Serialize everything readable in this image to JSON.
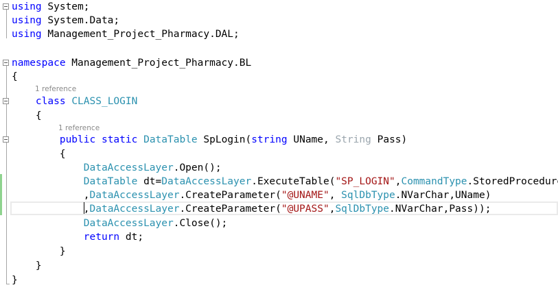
{
  "editor": {
    "language": "C#",
    "lines": [
      {
        "tokens": [
          {
            "c": "kw",
            "t": "using"
          },
          {
            "c": "tx",
            "t": " System;"
          }
        ]
      },
      {
        "tokens": [
          {
            "c": "kw",
            "t": "using"
          },
          {
            "c": "tx",
            "t": " System.Data;"
          }
        ]
      },
      {
        "tokens": [
          {
            "c": "kw",
            "t": "using"
          },
          {
            "c": "tx",
            "t": " Management_Project_Pharmacy.DAL;"
          }
        ]
      },
      {
        "tokens": []
      },
      {
        "tokens": [
          {
            "c": "kw",
            "t": "namespace"
          },
          {
            "c": "tx",
            "t": " Management_Project_Pharmacy.BL"
          }
        ]
      },
      {
        "tokens": [
          {
            "c": "tx",
            "t": "{"
          }
        ]
      },
      {
        "tokens": [
          {
            "c": "tx",
            "t": "    "
          },
          {
            "c": "kw",
            "t": "class"
          },
          {
            "c": "tx",
            "t": " "
          },
          {
            "c": "ty",
            "t": "CLASS_LOGIN"
          }
        ]
      },
      {
        "tokens": [
          {
            "c": "tx",
            "t": "    {"
          }
        ]
      },
      {
        "tokens": [
          {
            "c": "tx",
            "t": "        "
          },
          {
            "c": "kw",
            "t": "public"
          },
          {
            "c": "tx",
            "t": " "
          },
          {
            "c": "kw",
            "t": "static"
          },
          {
            "c": "tx",
            "t": " "
          },
          {
            "c": "ty",
            "t": "DataTable"
          },
          {
            "c": "tx",
            "t": " SpLogin("
          },
          {
            "c": "kw",
            "t": "string"
          },
          {
            "c": "tx",
            "t": " UName, "
          },
          {
            "c": "tyg",
            "t": "String"
          },
          {
            "c": "tx",
            "t": " Pass)"
          }
        ]
      },
      {
        "tokens": [
          {
            "c": "tx",
            "t": "        {"
          }
        ]
      },
      {
        "tokens": [
          {
            "c": "tx",
            "t": "            "
          },
          {
            "c": "ty",
            "t": "DataAccessLayer"
          },
          {
            "c": "tx",
            "t": ".Open();"
          }
        ]
      },
      {
        "tokens": [
          {
            "c": "tx",
            "t": "            "
          },
          {
            "c": "ty",
            "t": "DataTable"
          },
          {
            "c": "tx",
            "t": " dt="
          },
          {
            "c": "ty",
            "t": "DataAccessLayer"
          },
          {
            "c": "tx",
            "t": ".ExecuteTable("
          },
          {
            "c": "str",
            "t": "\"SP_LOGIN\""
          },
          {
            "c": "tx",
            "t": ","
          },
          {
            "c": "ty",
            "t": "CommandType"
          },
          {
            "c": "tx",
            "t": ".StoredProcedure"
          }
        ]
      },
      {
        "tokens": [
          {
            "c": "tx",
            "t": "            ,"
          },
          {
            "c": "ty",
            "t": "DataAccessLayer"
          },
          {
            "c": "tx",
            "t": ".CreateParameter("
          },
          {
            "c": "str",
            "t": "\"@UNAME\""
          },
          {
            "c": "tx",
            "t": ", "
          },
          {
            "c": "ty",
            "t": "SqlDbType"
          },
          {
            "c": "tx",
            "t": ".NVarChar,UName)"
          }
        ]
      },
      {
        "cursor": true,
        "tokens": [
          {
            "c": "tx",
            "t": "            ,"
          },
          {
            "c": "ty",
            "t": "DataAccessLayer"
          },
          {
            "c": "tx",
            "t": ".CreateParameter("
          },
          {
            "c": "str",
            "t": "\"@UPASS\""
          },
          {
            "c": "tx",
            "t": ","
          },
          {
            "c": "ty",
            "t": "SqlDbType"
          },
          {
            "c": "tx",
            "t": ".NVarChar,Pass));"
          }
        ]
      },
      {
        "tokens": [
          {
            "c": "tx",
            "t": "            "
          },
          {
            "c": "ty",
            "t": "DataAccessLayer"
          },
          {
            "c": "tx",
            "t": ".Close();"
          }
        ]
      },
      {
        "tokens": [
          {
            "c": "tx",
            "t": "            "
          },
          {
            "c": "kw",
            "t": "return"
          },
          {
            "c": "tx",
            "t": " dt;"
          }
        ]
      },
      {
        "tokens": [
          {
            "c": "tx",
            "t": "        }"
          }
        ]
      },
      {
        "tokens": [
          {
            "c": "tx",
            "t": "    }"
          }
        ]
      },
      {
        "tokens": [
          {
            "c": "tx",
            "t": "}"
          }
        ]
      }
    ],
    "codelens": [
      {
        "label": "1 reference",
        "before_line": 6
      },
      {
        "label": "1 reference",
        "before_line": 8
      }
    ]
  }
}
